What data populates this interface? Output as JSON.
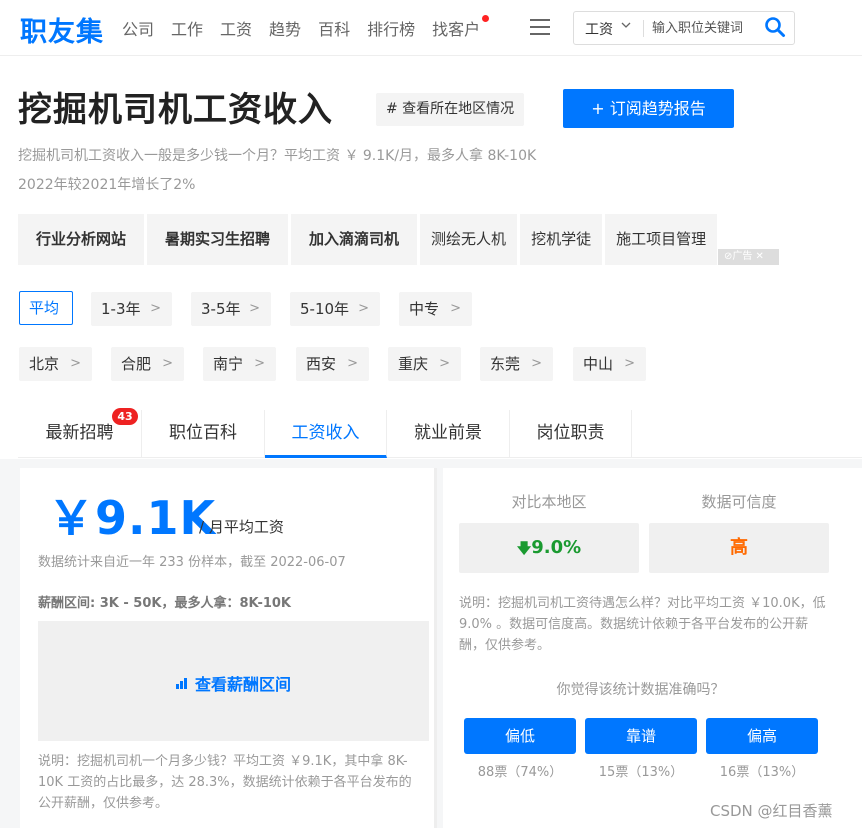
{
  "header": {
    "logo": "职友集",
    "nav": [
      "公司",
      "工作",
      "工资",
      "趋势",
      "百科",
      "排行榜",
      "找客户"
    ],
    "menu_icon": "menu-icon",
    "search": {
      "category": "工资",
      "placeholder": "输入职位关键词",
      "icon": "search-icon"
    }
  },
  "title": {
    "heading": "挖掘机司机工资收入",
    "region_tag": "# 查看所在地区情况",
    "subscribe": "+ 订阅趋势报告",
    "summary1": "挖掘机司机工资收入一般是多少钱一个月？平均工资 ￥ 9.1K/月，最多人拿 8K-10K",
    "summary2": "2022年较2021年增长了2%"
  },
  "ads": {
    "items": [
      "行业分析网站",
      "暑期实习生招聘",
      "加入滴滴司机",
      "测绘无人机",
      "挖机学徒",
      "施工项目管理"
    ],
    "mark": "⊘广告 ✕"
  },
  "filters": {
    "experience": [
      "平均",
      "1-3年",
      "3-5年",
      "5-10年",
      "中专"
    ],
    "cities": [
      "北京",
      "合肥",
      "南宁",
      "西安",
      "重庆",
      "东莞",
      "中山"
    ]
  },
  "tabs": {
    "items": [
      "最新招聘",
      "职位百科",
      "工资收入",
      "就业前景",
      "岗位职责"
    ],
    "badge": "43",
    "active": "工资收入"
  },
  "salary": {
    "amount": "￥9.1K",
    "unit": "/ 月平均工资",
    "note": "数据统计来自近一年 233 份样本，截至 2022-06-07",
    "range": "薪酬区间: 3K - 50K，最多人拿：8K-10K",
    "range_link": "查看薪酬区间",
    "desc": "说明：挖掘机司机一个月多少钱？平均工资 ￥9.1K，其中拿 8K-10K 工资的占比最多，达 28.3%，数据统计依赖于各平台发布的公开薪酬，仅供参考。"
  },
  "compare": {
    "local_label": "对比本地区",
    "local_value": "9.0%",
    "trust_label": "数据可信度",
    "trust_value": "高",
    "desc": "说明：挖掘机司机工资待遇怎么样？对比平均工资 ￥10.0K，低 9.0% 。数据可信度高。数据统计依赖于各平台发布的公开薪酬，仅供参考。",
    "question": "你觉得该统计数据准确吗？",
    "votes": [
      {
        "label": "偏低",
        "count": "88票（74%）"
      },
      {
        "label": "靠谱",
        "count": "15票（13%）"
      },
      {
        "label": "偏高",
        "count": "16票（13%）"
      }
    ]
  },
  "watermark": "CSDN @红目香薰",
  "colors": {
    "accent": "#0077ff",
    "down": "#1a9a30",
    "high": "#ff6a00",
    "badge": "#ee2222"
  }
}
